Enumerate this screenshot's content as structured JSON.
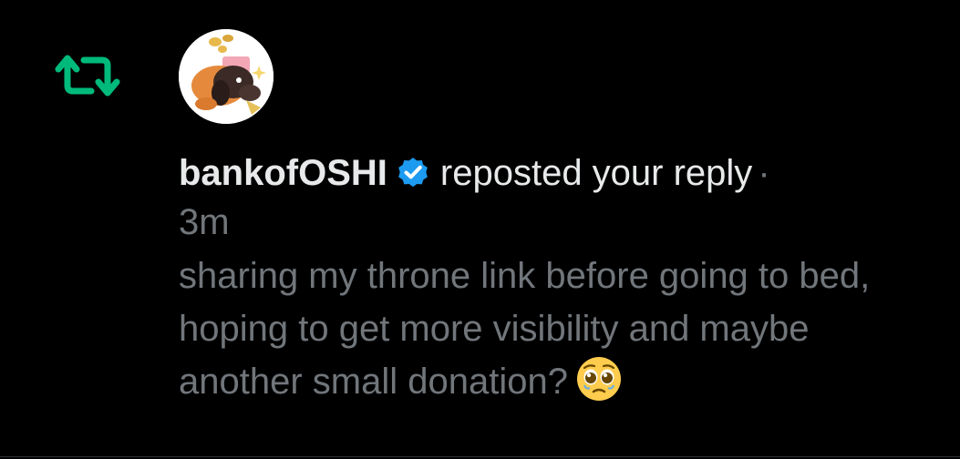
{
  "notification": {
    "type": "repost",
    "icon": "repost-icon",
    "accent_color": "#00ba7c",
    "avatar_icon": "avatar-cartoon-dog",
    "user": {
      "display_name": "bankofOSHI",
      "verified_icon": "verified-badge-icon",
      "verified_color": "#1d9bf0"
    },
    "action": "reposted your reply",
    "separator": "·",
    "timestamp": "3m",
    "reply_text": "sharing my throne link before going to bed, hoping to get more visibility and maybe another small donation?",
    "reply_emoji_icon": "pleading-face-emoji-icon"
  },
  "colors": {
    "background": "#000000",
    "primary_text": "#e7e9ea",
    "secondary_text": "#71767b",
    "divider": "#2f3336"
  }
}
